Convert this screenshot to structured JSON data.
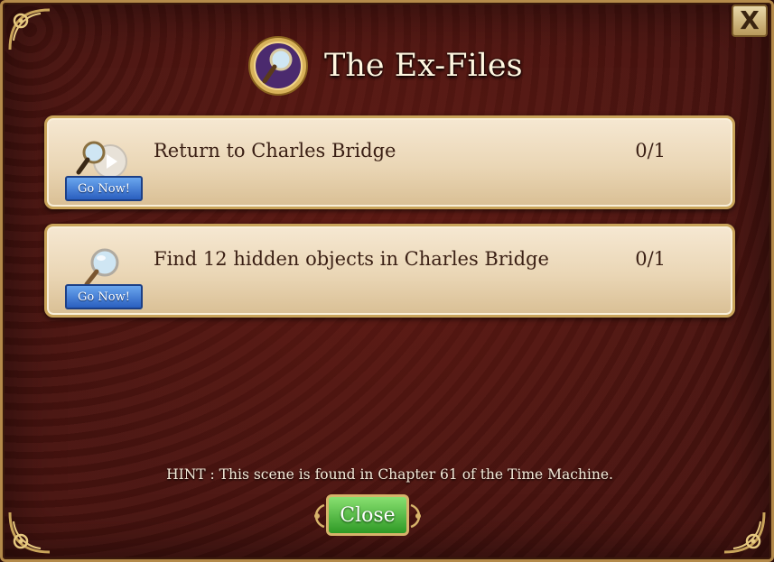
{
  "dialog": {
    "title": "The Ex-Files",
    "close_x_label": "X",
    "hint": "HINT : This scene is found in Chapter 61 of the Time Machine.",
    "close_label": "Close"
  },
  "tasks": [
    {
      "label": "Return to Charles Bridge",
      "count": "0/1",
      "button": "Go Now!",
      "icon": "magnifier-scene-icon"
    },
    {
      "label": "Find 12 hidden objects in Charles Bridge",
      "count": "0/1",
      "button": "Go Now!",
      "icon": "magnifier-icon"
    }
  ],
  "colors": {
    "panel_bg": "#4a1410",
    "frame_gold": "#c9a45a",
    "task_bg": "#ead6b5",
    "go_button": "#2a5fbf",
    "close_button": "#2f9a26"
  }
}
